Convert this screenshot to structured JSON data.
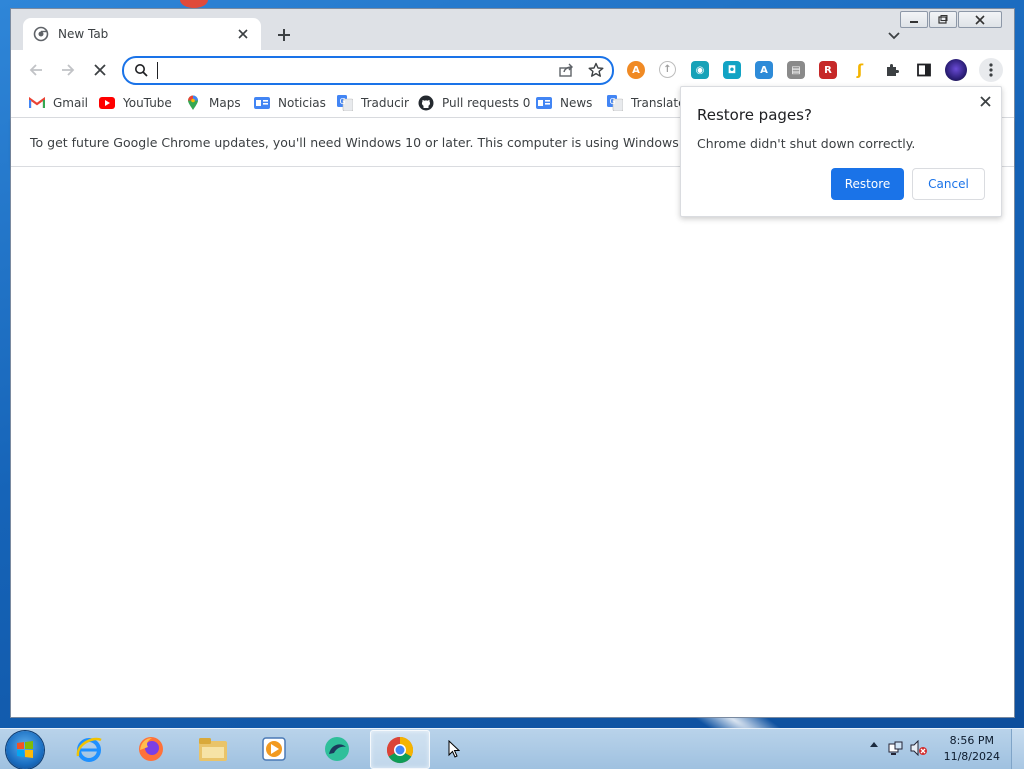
{
  "window": {
    "tab_title": "New Tab",
    "tab_icon": "chrome-newtab-icon",
    "minimize": "—",
    "maximize": "❐",
    "close": "✕"
  },
  "toolbar": {
    "omnibox_value": "",
    "extensions": [
      {
        "name": "orange-extension-icon",
        "color": "#f08a24",
        "glyph": "A"
      },
      {
        "name": "circle-arrow-extension-icon",
        "color": "#bdbdbd",
        "glyph": "↑"
      },
      {
        "name": "camera-extension-icon",
        "color": "#17a2b8",
        "glyph": "◉"
      },
      {
        "name": "teal-square-extension-icon",
        "color": "#12a3c4",
        "glyph": "◘"
      },
      {
        "name": "blue-translate-extension-icon",
        "color": "#2e8bd8",
        "glyph": "A"
      },
      {
        "name": "screenshot-extension-icon",
        "color": "#8a8a8a",
        "glyph": "▤"
      },
      {
        "name": "red-extension-icon",
        "color": "#c62828",
        "glyph": "R"
      },
      {
        "name": "yellow-extension-icon",
        "color": "#f4b400",
        "glyph": "ʃ"
      }
    ]
  },
  "bookmarks": [
    {
      "label": "Gmail",
      "icon": "gmail-icon"
    },
    {
      "label": "YouTube",
      "icon": "youtube-icon"
    },
    {
      "label": "Maps",
      "icon": "maps-icon"
    },
    {
      "label": "Noticias",
      "icon": "google-news-icon"
    },
    {
      "label": "Traducir",
      "icon": "google-translate-icon"
    },
    {
      "label": "Pull requests 0",
      "icon": "github-icon"
    },
    {
      "label": "News",
      "icon": "google-news-icon"
    },
    {
      "label": "Translate",
      "icon": "google-translate-icon"
    }
  ],
  "infobar": {
    "message": "To get future Google Chrome updates, you'll need Windows 10 or later. This computer is using Windows 7."
  },
  "dialog": {
    "title": "Restore pages?",
    "message": "Chrome didn't shut down correctly.",
    "restore_label": "Restore",
    "cancel_label": "Cancel"
  },
  "taskbar": {
    "time": "8:56 PM",
    "date": "11/8/2024",
    "apps": [
      "internet-explorer-icon",
      "firefox-icon",
      "file-explorer-icon",
      "media-player-icon",
      "chat-app-icon",
      "chrome-icon"
    ]
  },
  "colors": {
    "accent": "#1a73e8",
    "desktop": "#1664b8",
    "tab_strip": "#dee1e6"
  }
}
